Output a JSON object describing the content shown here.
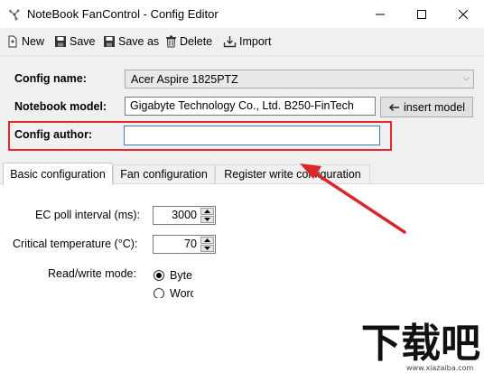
{
  "window": {
    "title": "NoteBook FanControl - Config Editor",
    "icons": {
      "app": "fan-icon",
      "minimize": "minimize-icon",
      "maximize": "maximize-icon",
      "close": "close-icon"
    }
  },
  "toolbar": {
    "new_label": "New",
    "save_label": "Save",
    "save_as_label": "Save as",
    "delete_label": "Delete",
    "import_label": "Import"
  },
  "form": {
    "config_name_label": "Config name:",
    "config_name_value": "Acer Aspire 1825PTZ",
    "notebook_model_label": "Notebook model:",
    "notebook_model_value": "Gigabyte Technology Co., Ltd. B250-FinTech",
    "insert_model_label": "insert model",
    "config_author_label": "Config author:",
    "config_author_value": ""
  },
  "tabs": [
    {
      "label": "Basic configuration",
      "active": true
    },
    {
      "label": "Fan configuration",
      "active": false
    },
    {
      "label": "Register write configuration",
      "active": false
    }
  ],
  "basic": {
    "ec_poll_label": "EC poll interval (ms):",
    "ec_poll_value": "3000",
    "critical_temp_label": "Critical temperature (°C):",
    "critical_temp_value": "70",
    "rw_mode_label": "Read/write mode:",
    "rw_options": [
      {
        "label": "Byte",
        "selected": true
      },
      {
        "label": "Word",
        "selected": false
      }
    ]
  },
  "colors": {
    "highlight": "#e8262b",
    "arrow": "#d9262b"
  },
  "watermark": {
    "text": "下载吧",
    "url": "www.xiazaiba.com"
  }
}
